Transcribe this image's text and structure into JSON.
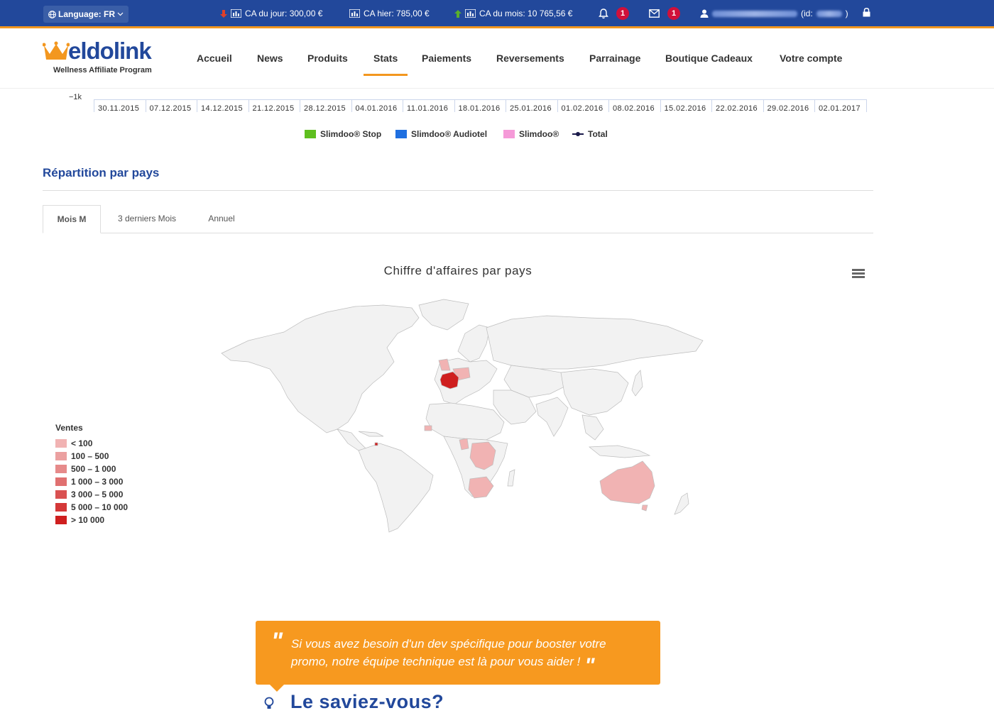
{
  "topbar": {
    "language_label": "Language: FR",
    "ca_jour": "CA du jour: 300,00 €",
    "ca_hier": "CA hier: 785,00 €",
    "ca_mois": "CA du mois: 10 765,56 €",
    "notifications_count": "1",
    "messages_count": "1",
    "user_id_prefix": "(id:",
    "user_id_suffix": ")",
    "icons": [
      "globe-icon",
      "chevron-down-icon",
      "arrow-down-icon",
      "bar-chart-icon",
      "arrow-up-icon",
      "bell-icon",
      "envelope-icon",
      "user-icon",
      "lock-icon"
    ],
    "colors": {
      "background": "#22489b",
      "accent": "#f3971f",
      "badge": "#d0103a"
    }
  },
  "logo": {
    "brand": "eldolink",
    "tagline": "Wellness Affiliate Program"
  },
  "nav": [
    {
      "label": "Accueil",
      "active": false
    },
    {
      "label": "News",
      "active": false
    },
    {
      "label": "Produits",
      "active": false
    },
    {
      "label": "Stats",
      "active": true
    },
    {
      "label": "Paiements",
      "active": false
    },
    {
      "label": "Reversements",
      "active": false
    },
    {
      "label": "Parrainage",
      "active": false
    },
    {
      "label": "Boutique Cadeaux",
      "active": false
    },
    {
      "label": "Votre compte",
      "active": false
    }
  ],
  "timeline_chart": {
    "y_tick": "−1k",
    "x_ticks": [
      "30.11.2015",
      "07.12.2015",
      "14.12.2015",
      "21.12.2015",
      "28.12.2015",
      "04.01.2016",
      "11.01.2016",
      "18.01.2016",
      "25.01.2016",
      "01.02.2016",
      "08.02.2016",
      "15.02.2016",
      "22.02.2016",
      "29.02.2016",
      "02.01.2017"
    ],
    "legend": [
      {
        "name": "Slimdoo® Stop",
        "color": "#5fbf1f"
      },
      {
        "name": "Slimdoo® Audiotel",
        "color": "#1f6fe0"
      },
      {
        "name": "Slimdoo®",
        "color": "#f59ad8"
      },
      {
        "name": "Total",
        "color": "#1a1a4a"
      }
    ]
  },
  "section": {
    "title": "Répartition par pays",
    "tabs": [
      {
        "label": "Mois M",
        "active": true
      },
      {
        "label": "3 derniers Mois",
        "active": false
      },
      {
        "label": "Annuel",
        "active": false
      }
    ]
  },
  "map": {
    "title": "Chiffre d'affaires par pays",
    "legend_title": "Ventes",
    "classes": [
      {
        "label": "< 100",
        "color": "#f1b3b3"
      },
      {
        "label": "100 – 500",
        "color": "#eba0a0"
      },
      {
        "label": "500 – 1 000",
        "color": "#e68a8a"
      },
      {
        "label": "1 000 – 3 000",
        "color": "#e07070"
      },
      {
        "label": "3 000 – 5 000",
        "color": "#d95151"
      },
      {
        "label": "5 000 – 10 000",
        "color": "#d43838"
      },
      {
        "label": "> 10 000",
        "color": "#cf1f1f"
      }
    ]
  },
  "tip": {
    "text": "Si vous avez besoin d'un dev spécifique pour booster votre promo, notre équipe technique est là pour vous aider !",
    "heading": "Le saviez-vous?",
    "color": "#f7991f"
  }
}
